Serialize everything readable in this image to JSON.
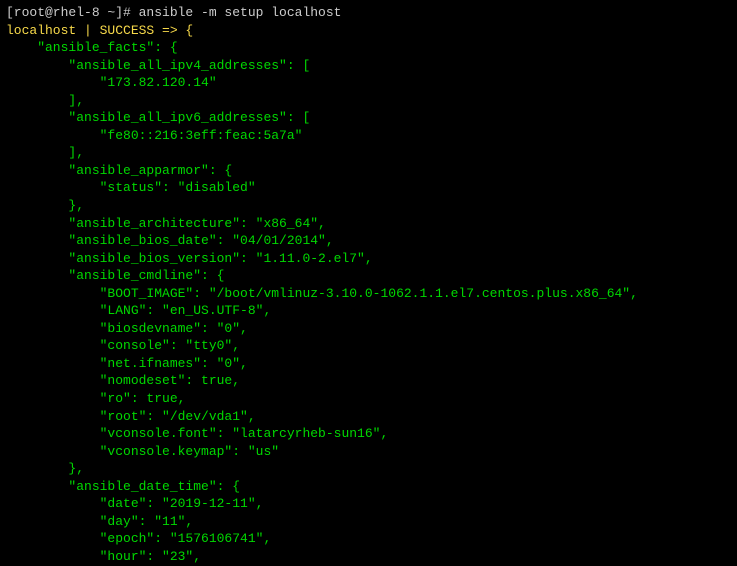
{
  "prompt": "[root@rhel-8 ~]# ansible -m setup localhost",
  "success": "localhost | SUCCESS => {",
  "lines": [
    "    \"ansible_facts\": {",
    "        \"ansible_all_ipv4_addresses\": [",
    "            \"173.82.120.14\"",
    "        ],",
    "        \"ansible_all_ipv6_addresses\": [",
    "            \"fe80::216:3eff:feac:5a7a\"",
    "        ],",
    "        \"ansible_apparmor\": {",
    "            \"status\": \"disabled\"",
    "        },",
    "        \"ansible_architecture\": \"x86_64\",",
    "        \"ansible_bios_date\": \"04/01/2014\",",
    "        \"ansible_bios_version\": \"1.11.0-2.el7\",",
    "        \"ansible_cmdline\": {",
    "            \"BOOT_IMAGE\": \"/boot/vmlinuz-3.10.0-1062.1.1.el7.centos.plus.x86_64\",",
    "            \"LANG\": \"en_US.UTF-8\",",
    "            \"biosdevname\": \"0\",",
    "            \"console\": \"tty0\",",
    "            \"net.ifnames\": \"0\",",
    "            \"nomodeset\": true,",
    "            \"ro\": true,",
    "            \"root\": \"/dev/vda1\",",
    "            \"vconsole.font\": \"latarcyrheb-sun16\",",
    "            \"vconsole.keymap\": \"us\"",
    "        },",
    "        \"ansible_date_time\": {",
    "            \"date\": \"2019-12-11\",",
    "            \"day\": \"11\",",
    "            \"epoch\": \"1576106741\",",
    "            \"hour\": \"23\","
  ]
}
